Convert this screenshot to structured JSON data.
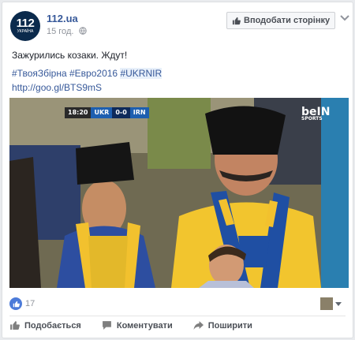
{
  "page": {
    "name": "112.ua",
    "time": "15 год.",
    "avatar_text": "112",
    "avatar_sub": "УКРАЇНА"
  },
  "header": {
    "like_page_label": "Вподобати сторінку"
  },
  "post": {
    "text": "Зажурились козаки. Ждут!",
    "tags": [
      "#ТвояЗбірна",
      "#Евро2016",
      "#UKRNIR"
    ],
    "link": "http://goo.gl/BTS9mS"
  },
  "video": {
    "scorebug": {
      "time": "18:20",
      "home": "UKR",
      "score": "0-0",
      "away": "IRN"
    },
    "broadcaster": "beIN",
    "broadcaster_sub": "SPORTS"
  },
  "reactions": {
    "count": "17"
  },
  "actions": {
    "like": "Подобається",
    "comment": "Коментувати",
    "share": "Поширити"
  },
  "colors": {
    "link": "#365899",
    "muted": "#90949c",
    "like_badge": "#4c7bd9",
    "scarf_yellow": "#f2c12e",
    "scarf_blue": "#1f4fa3"
  }
}
